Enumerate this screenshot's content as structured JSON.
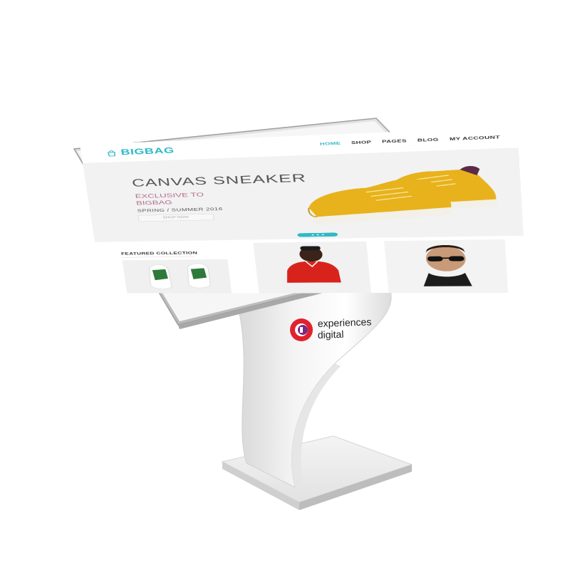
{
  "site": {
    "logo_text": "BIGBAG",
    "nav": [
      "HOME",
      "SHOP",
      "PAGES",
      "BLOG",
      "MY ACCOUNT"
    ]
  },
  "hero": {
    "title": "CANVAS SNEAKER",
    "subtitle_line1": "EXCLUSIVE TO",
    "subtitle_line2": "BIGBAG",
    "season": "SPRING / SUMMER 2016",
    "button_label": "SHOP NOW"
  },
  "featured": {
    "title": "FEATURED COLLECTION"
  },
  "brand": {
    "name_line1": "experiences",
    "name_line2": "digital"
  },
  "colors": {
    "accent": "#2fb9c9",
    "kiosk": "#efefef",
    "logo_red": "#e2222b",
    "logo_purple": "#7a2b82",
    "sneaker": "#e8b21c"
  },
  "icons": [
    "bag-icon",
    "experiences-digital-logo"
  ]
}
